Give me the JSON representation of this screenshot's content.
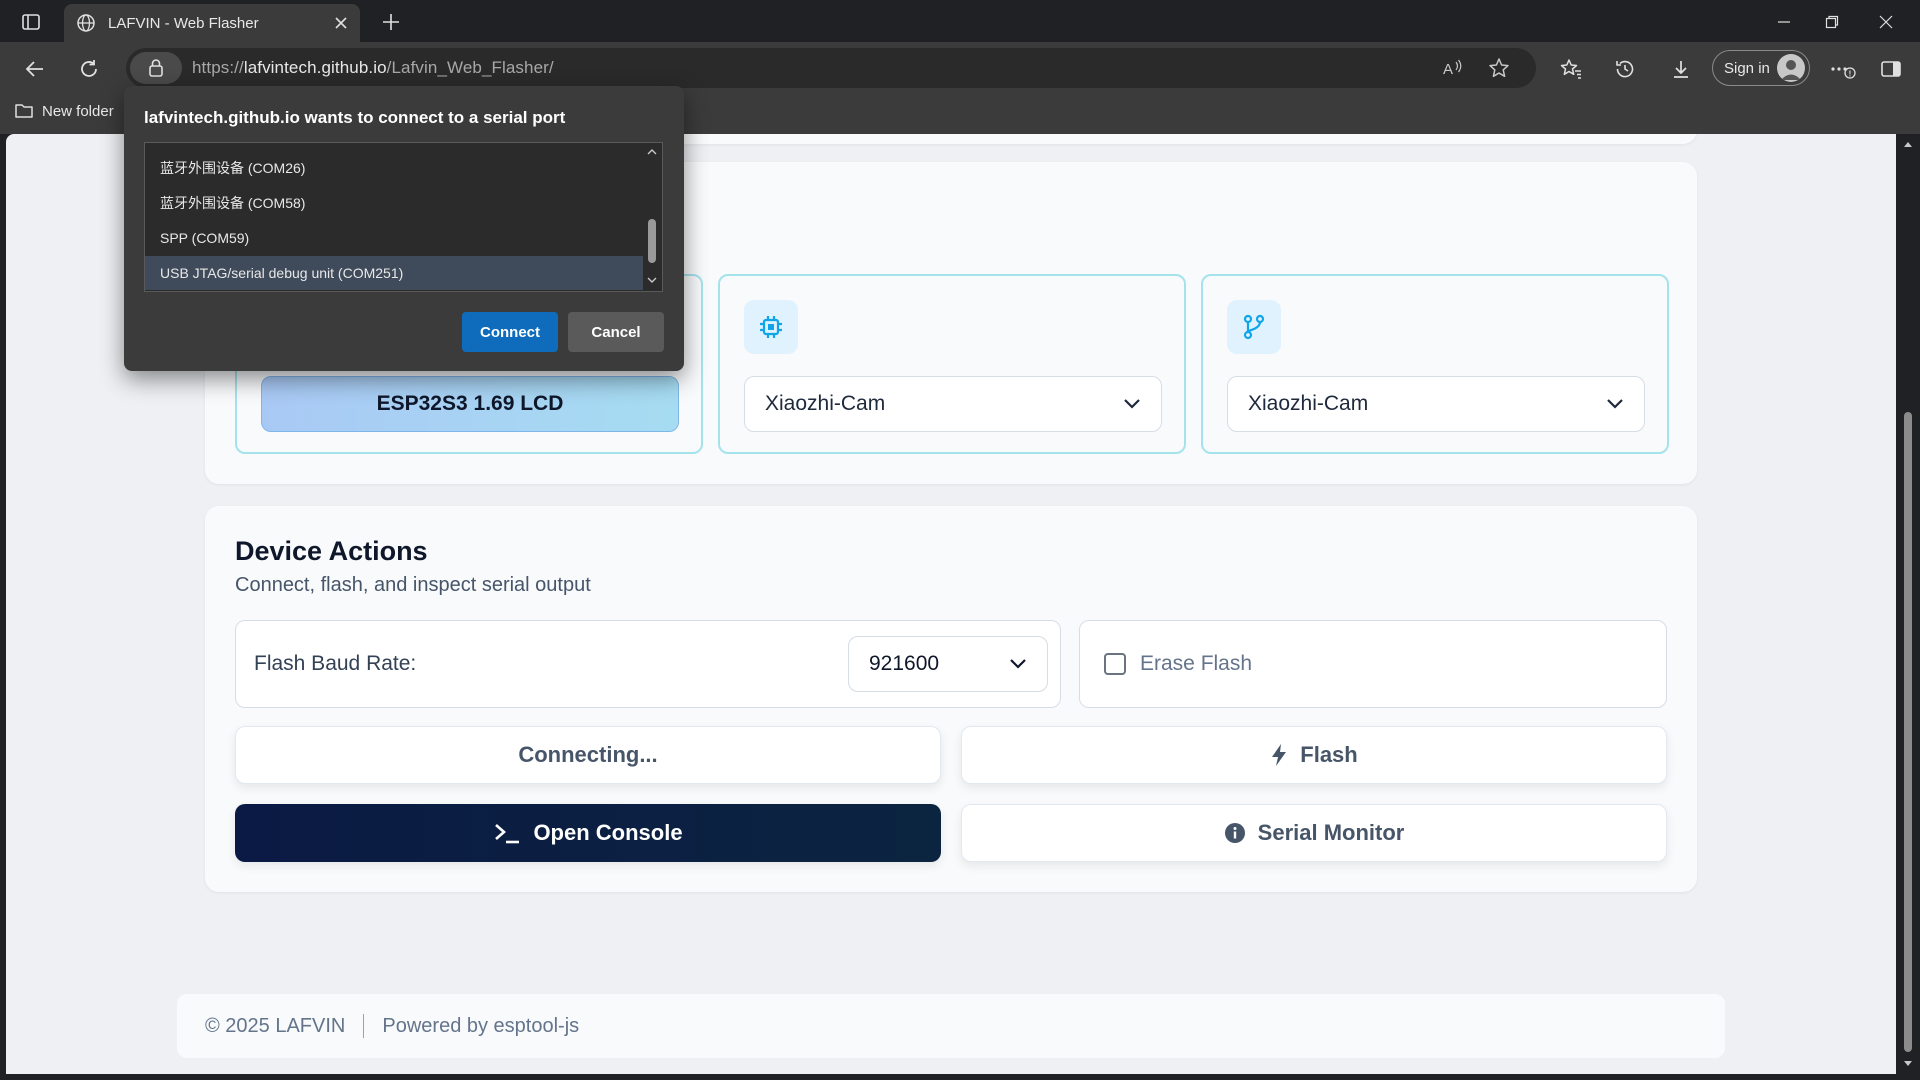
{
  "browser": {
    "tab_title": "LAFVIN - Web Flasher",
    "url_prefix": "https://",
    "url_host": "lafvintech.github.io",
    "url_path": "/Lafvin_Web_Flasher/",
    "sign_in_label": "Sign in",
    "bookmark_folder": "New folder"
  },
  "dialog": {
    "title": "lafvintech.github.io wants to connect to a serial port",
    "ports": [
      "蓝牙外围设备 (COM26)",
      "蓝牙外围设备 (COM58)",
      "SPP (COM59)",
      "USB JTAG/serial debug unit (COM251)"
    ],
    "selected_port": "USB JTAG/serial debug unit (COM251)",
    "connect_label": "Connect",
    "cancel_label": "Cancel"
  },
  "selection": {
    "board_label": "ESP32S3 1.69 LCD",
    "chip_value": "Xiaozhi-Cam",
    "branch_value": "Xiaozhi-Cam"
  },
  "actions": {
    "title": "Device Actions",
    "subtitle": "Connect, flash, and inspect serial output",
    "baud_label": "Flash Baud Rate:",
    "baud_value": "921600",
    "erase_label": "Erase Flash",
    "erase_checked": false,
    "connect_label": "Connecting...",
    "flash_label": "Flash",
    "console_label": "Open Console",
    "monitor_label": "Serial Monitor"
  },
  "footer": {
    "copyright": "© 2025 LAFVIN",
    "powered": "Powered by esptool-js"
  },
  "colors": {
    "accent": "#0f6cbd",
    "console_bg": "#0b1a44",
    "card_border": "#a5e3ec",
    "icon_color": "#0ea5e9"
  }
}
